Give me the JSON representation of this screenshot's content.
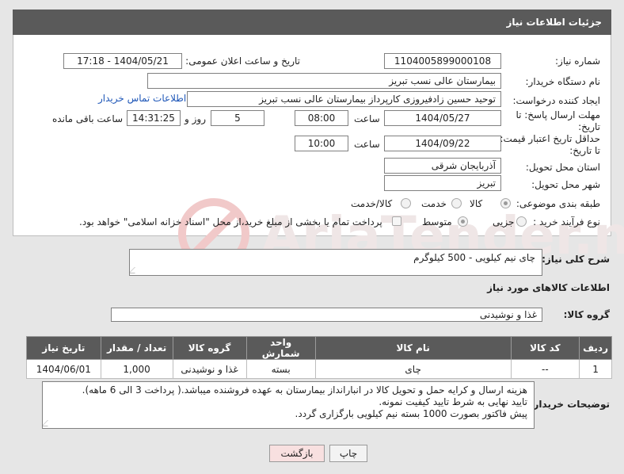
{
  "header": {
    "title": "جزئیات اطلاعات نیاز"
  },
  "fields": {
    "need_number_label": "شماره نیاز:",
    "need_number": "1104005899000108",
    "announce_label": "تاریخ و ساعت اعلان عمومی:",
    "announce_value": "1404/05/21 - 17:18",
    "buyer_org_label": "نام دستگاه خریدار:",
    "buyer_org": "بیمارستان عالی نسب تبریز",
    "requester_label": "ایجاد کننده درخواست:",
    "requester": "توحید حسین زادفیروزی کارپرداز بیمارستان عالی نسب تبریز",
    "contact_link": "اطلاعات تماس خریدار",
    "deadline_label_1": "مهلت ارسال پاسخ: تا",
    "deadline_label_2": "تاریخ:",
    "deadline_date": "1404/05/27",
    "time_label": "ساعت",
    "deadline_time": "08:00",
    "days_value": "5",
    "days_label": "روز و",
    "remaining_time": "14:31:25",
    "remaining_label": "ساعت باقی مانده",
    "validity_label_1": "حداقل تاریخ اعتبار قیمت:",
    "validity_label_2": "تا تاریخ:",
    "validity_date": "1404/09/22",
    "validity_time": "10:00",
    "province_label": "استان محل تحویل:",
    "province": "آذربایجان شرقی",
    "city_label": "شهر محل تحویل:",
    "city": "تبریز",
    "category_label": "طبقه بندی موضوعی:",
    "category_options": [
      "کالا",
      "خدمت",
      "کالا/خدمت"
    ],
    "category_selected": "کالا",
    "process_label": "نوع فرآیند خرید :",
    "process_options": [
      "جزیی",
      "متوسط"
    ],
    "process_selected": "متوسط",
    "payment_note": "پرداخت تمام یا بخشی از مبلغ خرید،از محل \"اسناد خزانه اسلامی\" خواهد بود."
  },
  "description": {
    "label": "شرح کلی نیاز:",
    "value": "چای نیم کیلویی - 500 کیلوگرم"
  },
  "goods_section": {
    "title": "اطلاعات کالاهای مورد نیاز",
    "group_label": "گروه کالا:",
    "group_value": "غذا و نوشیدنی"
  },
  "table": {
    "headers": [
      "ردیف",
      "کد کالا",
      "نام کالا",
      "واحد شمارش",
      "گروه کالا",
      "تعداد / مقدار",
      "تاریخ نیاز"
    ],
    "rows": [
      [
        "1",
        "--",
        "چای",
        "بسته",
        "غذا و نوشیدنی",
        "1,000",
        "1404/06/01"
      ]
    ]
  },
  "buyer_notes": {
    "label": "توضیحات خریدار:",
    "lines": [
      "هزینه ارسال و کرایه حمل و تحویل کالا در انبارانداز بیمارستان به عهده فروشنده میباشد.( پرداخت 3 الی 6 ماهه).",
      "تایید نهایی به شرط تایید کیفیت نمونه.",
      "پیش فاکتور بصورت 1000 بسته نیم کیلویی بارگزاری گردد."
    ]
  },
  "buttons": {
    "print": "چاپ",
    "back": "بازگشت"
  },
  "watermark": {
    "text": "AriaTender.neT"
  },
  "colors": {
    "header_bg": "#5a5a5a",
    "link": "#1f57b8",
    "back_button_bg": "#f8e0e0"
  }
}
